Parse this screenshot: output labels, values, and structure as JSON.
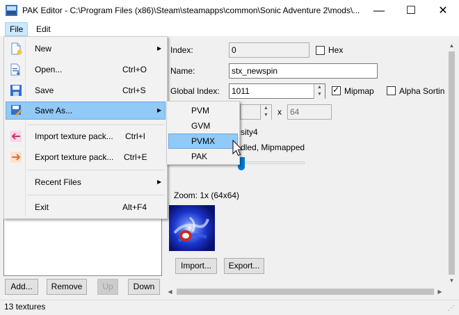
{
  "window": {
    "title": "PAK Editor - C:\\Program Files (x86)\\Steam\\steamapps\\common\\Sonic Adventure 2\\mods\\...",
    "minimize": "—",
    "maximize": "☐",
    "close": "✕"
  },
  "menubar": {
    "file": "File",
    "edit": "Edit"
  },
  "file_menu": {
    "new": "New",
    "open": "Open...",
    "open_shortcut": "Ctrl+O",
    "save": "Save",
    "save_shortcut": "Ctrl+S",
    "save_as": "Save As...",
    "import": "Import texture pack...",
    "import_shortcut": "Ctrl+I",
    "export": "Export texture pack...",
    "export_shortcut": "Ctrl+E",
    "recent": "Recent Files",
    "exit": "Exit",
    "exit_shortcut": "Alt+F4"
  },
  "save_as_menu": [
    "PVM",
    "GVM",
    "PVMX",
    "PAK"
  ],
  "save_as_selected": "PVMX",
  "left_buttons": {
    "add": "Add...",
    "remove": "Remove",
    "up": "Up",
    "down": "Down"
  },
  "props": {
    "index_label": "Index:",
    "index_value": "0",
    "hex_label": "Hex",
    "name_label": "Name:",
    "name_value": "stx_newspin",
    "gindex_label": "Global Index:",
    "gindex_value": "1011",
    "mipmap_label": "Mipmap",
    "mipmap_checked": true,
    "alpha_label": "Alpha Sortin",
    "dim_x": "x",
    "height_value": "64",
    "format_partial": "sity4",
    "pixel_partial": "dled, Mipmapped",
    "zoom_label": "Zoom: 1x (64x64)",
    "import_btn": "Import...",
    "export_btn": "Export..."
  },
  "status": {
    "text": "13 textures"
  },
  "colors": {
    "accent": "#0078d7",
    "menu_highlight": "#91c9f7",
    "menu_active": "#cce8ff"
  }
}
